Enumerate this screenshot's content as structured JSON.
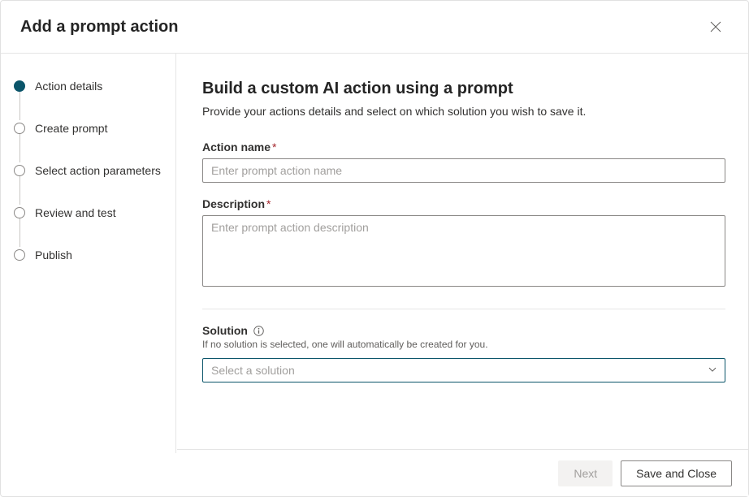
{
  "header": {
    "title": "Add a prompt action"
  },
  "steps": [
    {
      "label": "Action details",
      "active": true
    },
    {
      "label": "Create prompt",
      "active": false
    },
    {
      "label": "Select action parameters",
      "active": false
    },
    {
      "label": "Review and test",
      "active": false
    },
    {
      "label": "Publish",
      "active": false
    }
  ],
  "main": {
    "title": "Build a custom AI action using a prompt",
    "subtitle": "Provide your actions details and select on which solution you wish to save it.",
    "action_name": {
      "label": "Action name",
      "required": "*",
      "placeholder": "Enter prompt action name",
      "value": ""
    },
    "description": {
      "label": "Description",
      "required": "*",
      "placeholder": "Enter prompt action description",
      "value": ""
    },
    "solution": {
      "label": "Solution",
      "help": "If no solution is selected, one will automatically be created for you.",
      "placeholder": "Select a solution",
      "value": ""
    }
  },
  "footer": {
    "next": "Next",
    "save_close": "Save and Close"
  }
}
